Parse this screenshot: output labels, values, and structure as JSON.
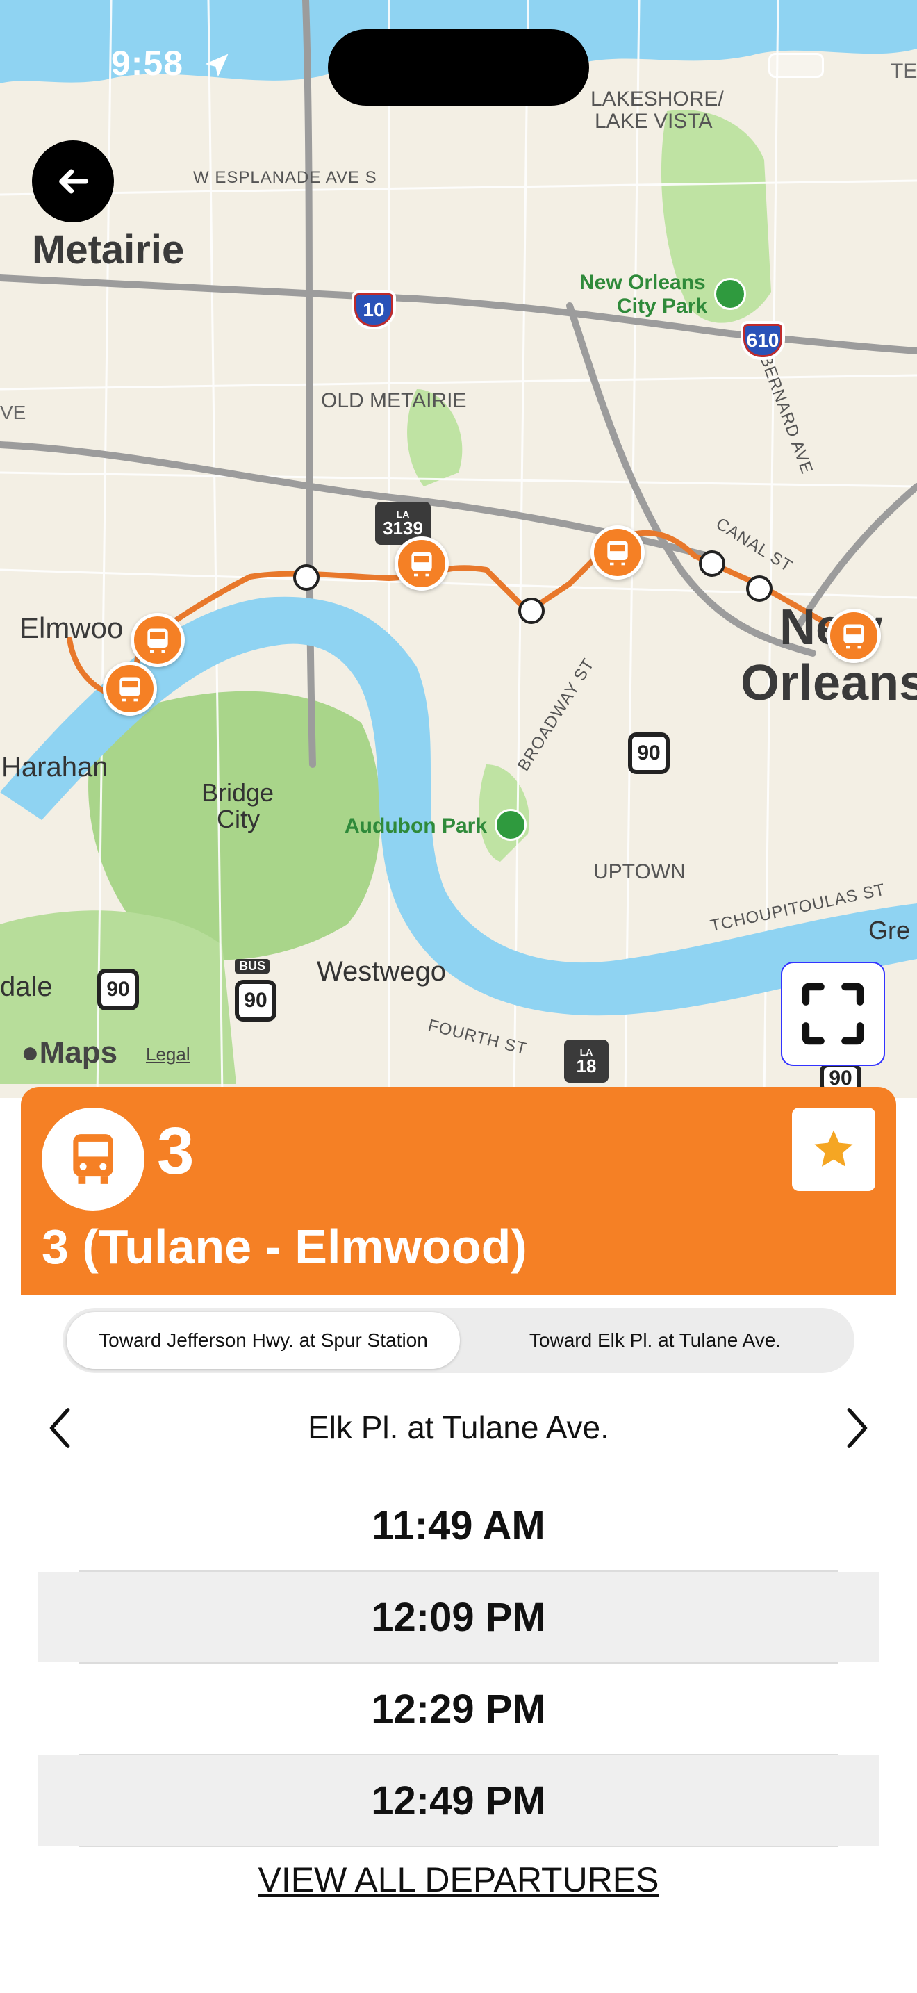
{
  "status_bar": {
    "time": "9:58"
  },
  "map": {
    "places": {
      "metairie": "Metairie",
      "lakeshore": "LAKESHORE/",
      "lake_vista": "LAKE VISTA",
      "old_metairie": "OLD METAIRIE",
      "elmwood": "Elmwoo",
      "harahan": "Harahan",
      "bridge": "Bridge",
      "city": "City",
      "new_orleans_1": "New",
      "new_orleans_2": "Orleans",
      "uptown": "UPTOWN",
      "westwego": "Westwego",
      "dale": "dale",
      "gre": "Gre",
      "te": "TE",
      "ve": "VE"
    },
    "streets": {
      "esplanade": "W ESPLANADE AVE S",
      "canal": "CANAL ST",
      "st_bernard": "ST BERNARD AVE",
      "broadway": "BROADWAY ST",
      "tchoupitoulas": "TCHOUPITOULAS ST",
      "fourth": "FOURTH ST"
    },
    "parks": {
      "city_park_1": "New Orleans",
      "city_park_2": "City Park",
      "audubon": "Audubon Park"
    },
    "shields": {
      "i10": "10",
      "i610": "610",
      "la3139_top": "LA",
      "la3139": "3139",
      "us90_a": "90",
      "us90_b": "90",
      "us90_c": "90",
      "us90_d": "90",
      "bus_tag": "BUS",
      "la18_top": "LA",
      "la18": "18"
    },
    "attribution": {
      "maps": "Maps",
      "legal": "Legal"
    }
  },
  "route": {
    "number": "3",
    "name": "3 (Tulane - Elmwood)",
    "accent_color": "#f58025"
  },
  "directions": [
    {
      "label": "Toward Jefferson Hwy. at Spur Station",
      "active": true
    },
    {
      "label": "Toward Elk Pl. at Tulane Ave.",
      "active": false
    }
  ],
  "stop": {
    "name": "Elk Pl. at Tulane Ave."
  },
  "departures": [
    "11:49 AM",
    "12:09 PM",
    "12:29 PM",
    "12:49 PM"
  ],
  "view_all_label": "VIEW ALL DEPARTURES",
  "icons": {
    "back": "back-arrow-icon",
    "location": "location-arrow-icon",
    "favorite": "star-icon",
    "expand": "expand-icon",
    "prev": "chevron-left-icon",
    "next": "chevron-right-icon",
    "bus": "bus-icon"
  }
}
